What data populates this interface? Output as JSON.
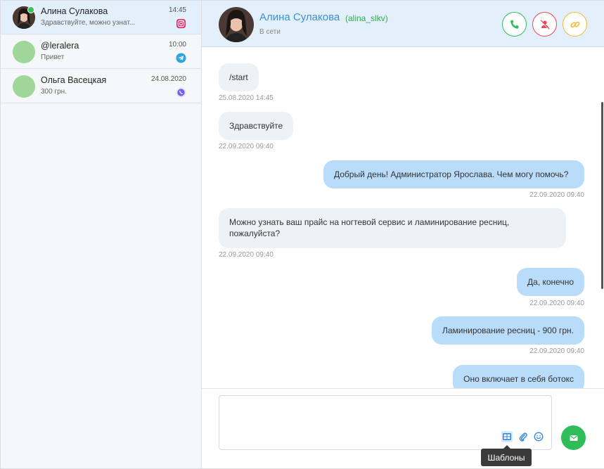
{
  "sidebar": {
    "chats": [
      {
        "name": "Алина Сулакова",
        "preview": "Здравствуйте, можно узнат...",
        "time": "14:45",
        "source_icon": "instagram-icon",
        "online": true,
        "active": true
      },
      {
        "name": "@leralera",
        "preview": "Привет",
        "time": "10:00",
        "source_icon": "telegram-icon",
        "online": false,
        "active": false
      },
      {
        "name": "Ольга Васецкая",
        "preview": "300 грн.",
        "time": "24.08.2020",
        "source_icon": "viber-icon",
        "online": false,
        "active": false
      }
    ]
  },
  "header": {
    "name": "Алина Сулакова",
    "handle": "(alina_slkv)",
    "status": "В сети",
    "buttons": [
      "phone-icon",
      "block-icon",
      "link-icon"
    ]
  },
  "messages": [
    {
      "direction": "in",
      "text": "/start",
      "time": "25.08.2020 14:45"
    },
    {
      "direction": "in",
      "text": "Здравствуйте",
      "time": "22.09.2020 09:40"
    },
    {
      "direction": "out",
      "text": "Добрый день! Администратор Ярослава. Чем могу помочь?",
      "time": "22.09.2020 09:40"
    },
    {
      "direction": "in",
      "text": "Можно узнать ваш прайс на ногтевой сервис и ламинирование ресниц, пожалуйста?",
      "time": "22.09.2020 09:40"
    },
    {
      "direction": "out",
      "text": "Да, конечно",
      "time": "22.09.2020 09:40"
    },
    {
      "direction": "out",
      "text": "Ламинирование ресниц - 900 грн.",
      "time": "22.09.2020 09:40"
    },
    {
      "direction": "out",
      "text": "Оно включает в себя ботокс",
      "time": ""
    }
  ],
  "composer": {
    "placeholder": "",
    "tools": [
      "templates-icon",
      "paperclip-icon",
      "smile-icon"
    ],
    "send_icon": "envelope-icon",
    "tooltip": "Шаблоны"
  },
  "colors": {
    "accent_blue": "#3a8fde",
    "online_green": "#34c759",
    "call_green": "#2ebd59",
    "block_red": "#e84855",
    "link_orange": "#f5b93b",
    "incoming_bubble": "#edf2f7",
    "outgoing_bubble": "#b9dcfb",
    "active_chat_bg": "#e3effb"
  }
}
